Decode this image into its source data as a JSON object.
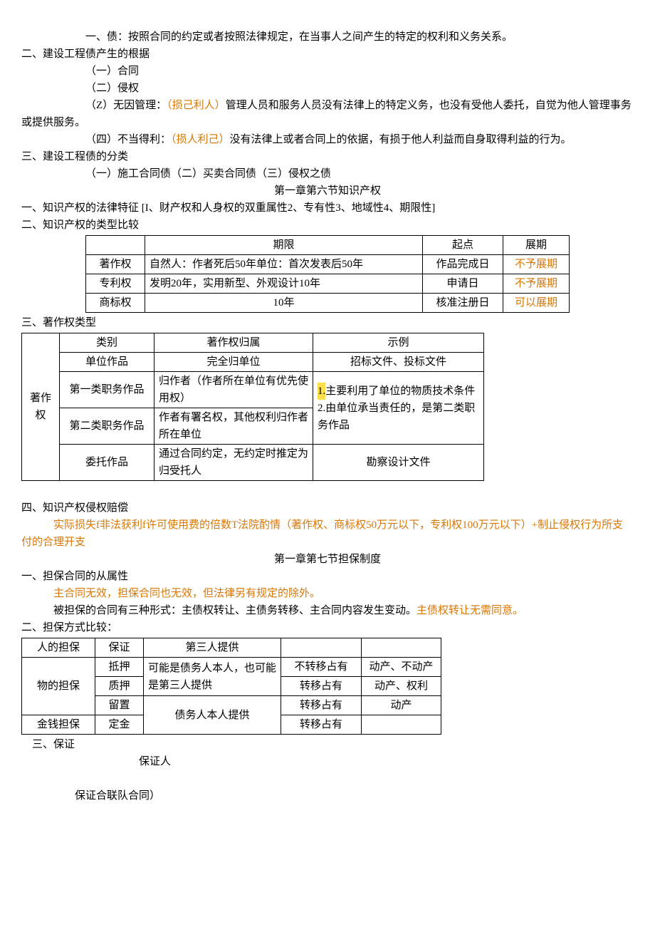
{
  "para": {
    "p1": "一、债：按照合同的约定或者按照法律规定，在当事人之间产生的特定的权利和义务关系。",
    "p2": "二、建设工程债产生的根据",
    "p3": "（一）合同",
    "p4": "（二）侵权",
    "p5a": "（Z）无因管理：",
    "p5b": "（损己利人）",
    "p5c": "管理人员和服务人员没有法律上的特定义务，也没有受他人委托，自觉为他人管理事务或提供服务。",
    "p6a": "（四）不当得利：",
    "p6b": "（损人利己）",
    "p6c": "没有法律上或者合同上的依据，有损于他人利益而自身取得利益的行为。",
    "p7": "三、建设工程债的分类",
    "p8": "（一）施工合同债（二）买卖合同债（三）侵权之债",
    "s1": "第一章第六节知识产权",
    "p9a": "一、知识产权的法律特征 [I、财产权和人身权的双重属性2、专有性3、地域性4、期限性]",
    "p10": "二、知识产权的类型比较",
    "p11": "三、著作权类型",
    "p12": "四、知识产权侵权赔偿",
    "p13": "实际损失f非法获利f许可使用费的倍数T法院酌情（著作权、商标权50万元以下，专利权100万元以下）+制止侵权行为所支付的合理开支",
    "s2": "第一章第七节担保制度",
    "p14": "一、担保合同的从属性",
    "p15": "主合同无效，担保合同也无效，但法律另有规定的除外。",
    "p16a": "被担保的合同有三种形式：主债权转让、主债务转移、主合同内容发生变动。",
    "p16b": "主债权转让无需同意。",
    "p17": "二、担保方式比较：",
    "p18": "三、保证",
    "p19": "保证人",
    "p20": "保证合联队合同）"
  },
  "table1": {
    "h1": "",
    "h2": "期限",
    "h3": "起点",
    "h4": "展期",
    "r1c1": "著作权",
    "r1c2": "自然人：作者死后50年单位：首次发表后50年",
    "r1c3": "作品完成日",
    "r1c4": "不予展期",
    "r2c1": "专利权",
    "r2c2": "发明20年，实用新型、外观设计10年",
    "r2c3": "申请日",
    "r2c4": "不予展期",
    "r3c1": "商标权",
    "r3c2": "10年",
    "r3c3": "核准注册日",
    "r3c4": "可以展期"
  },
  "table2": {
    "side": "著作权",
    "h1": "类别",
    "h2": "著作权归属",
    "h3": "示例",
    "r1c1": "单位作品",
    "r1c2": "完全归单位",
    "r1c3": "招标文件、投标文件",
    "r2c1": "第一类职务作品",
    "r2c2": "归作者（作者所在单位有优先使用权）",
    "r2c3a": "1.",
    "r2c3b": "主要利用了单位的物质技术条件",
    "r3c1": "第二类职务作品",
    "r3c2": "作者有署名权，其他权利归作者所在单位",
    "r3c3": "2.由单位承当责任的，是第二类职务作品",
    "r4c1": "委托作品",
    "r4c2": "通过合同约定，无约定时推定为归受托人",
    "r4c3": "勘察设计文件"
  },
  "table3": {
    "r1c1": "人的担保",
    "r1c2": "保证",
    "r1c3": "第三人提供",
    "r1c4": "",
    "r1c5": "",
    "r2c1": "物的担保",
    "r2c2": "抵押",
    "r2c3": "可能是债务人本人，也可能是第三人提供",
    "r2c4": "不转移占有",
    "r2c5": "动产、不动产",
    "r3c2": "质押",
    "r3c4": "转移占有",
    "r3c5": "动产、权利",
    "r4c2": "留置",
    "r4c3": "债务人本人提供",
    "r4c4": "转移占有",
    "r4c5": "动产",
    "r5c1": "金钱担保",
    "r5c2": "定金",
    "r5c4": "转移占有",
    "r5c5": ""
  }
}
